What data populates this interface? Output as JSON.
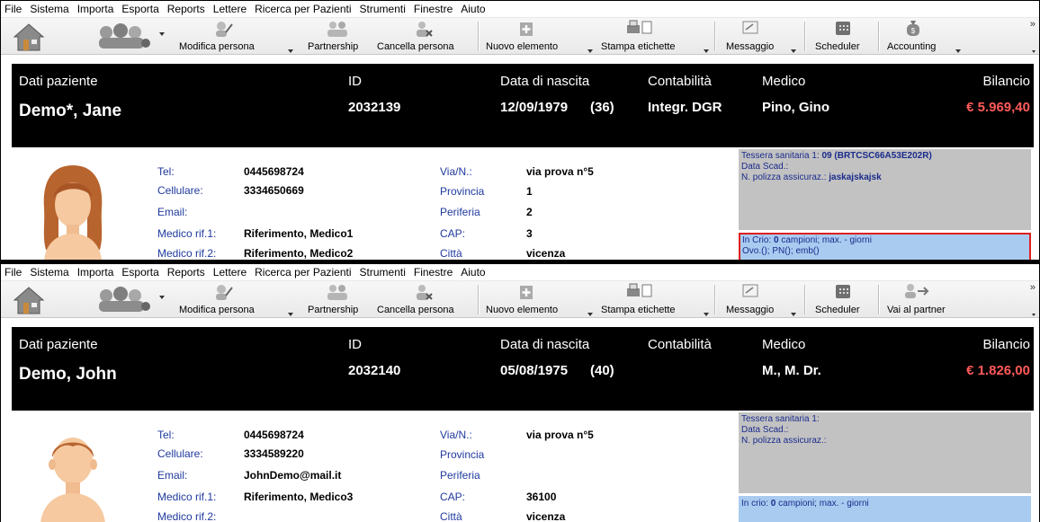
{
  "menu": [
    "File",
    "Sistema",
    "Importa",
    "Esporta",
    "Reports",
    "Lettere",
    "Ricerca per Pazienti",
    "Strumenti",
    "Finestre",
    "Aiuto"
  ],
  "toolbar": {
    "modifica": "Modifica persona",
    "partnership": "Partnership",
    "cancella": "Cancella persona",
    "nuovo": "Nuovo elemento",
    "stampa": "Stampa etichette",
    "messaggio": "Messaggio",
    "scheduler": "Scheduler",
    "accounting": "Accounting",
    "vai_partner": "Vai al partner",
    "more": "»"
  },
  "labels": {
    "dati_paziente": "Dati paziente",
    "id": "ID",
    "data_nascita": "Data di nascita",
    "contabilita": "Contabilità",
    "medico": "Medico",
    "bilancio": "Bilancio",
    "tel": "Tel:",
    "cellulare": "Cellulare:",
    "email": "Email:",
    "medico_rif1": "Medico rif.1:",
    "medico_rif2": "Medico rif.2:",
    "via": "Via/N.:",
    "provincia": "Provincia",
    "periferia": "Periferia",
    "cap": "CAP:",
    "citta": "Città",
    "data_scad": "Data Scad.:",
    "polizza": "N. polizza assicuraz.:"
  },
  "patients": [
    {
      "name": "Demo*, Jane",
      "id": "2032139",
      "birth": "12/09/1979",
      "age": "(36)",
      "contabilita": "Integr. DGR",
      "medico": "Pino, Gino",
      "bilancio": "€ 5.969,40",
      "tel": "0445698724",
      "cellulare": "3334650669",
      "email": "",
      "medico_rif1": "Riferimento, Medico1",
      "medico_rif2": "Riferimento, Medico2",
      "via": "via prova n°5",
      "provincia": "1",
      "periferia": "2",
      "cap": "3",
      "citta": "vicenza",
      "tessera_label": "Tessera sanitaria 1:",
      "tessera_value": "09  (BRTCSC66A53E202R)",
      "polizza_value": "jaskajskajsk",
      "crio_prefix": "In Crio:",
      "crio_count": "0",
      "crio_suffix": "campioni; max. - giorni",
      "crio_line2": "Ovo.(); PN(); emb()"
    },
    {
      "name": "Demo, John",
      "id": "2032140",
      "birth": "05/08/1975",
      "age": "(40)",
      "contabilita": "",
      "medico": "M., M. Dr.",
      "bilancio": "€ 1.826,00",
      "tel": "0445698724",
      "cellulare": "3334589220",
      "email": "JohnDemo@mail.it",
      "medico_rif1": "Riferimento, Medico3",
      "medico_rif2": "",
      "via": "via prova n°5",
      "provincia": "",
      "periferia": "",
      "cap": "36100",
      "citta": "vicenza",
      "tessera_label": "Tessera sanitaria 1:",
      "tessera_value": "",
      "polizza_value": "",
      "crio_prefix": "In crio:",
      "crio_count": "0",
      "crio_suffix": "campioni; max. - giorni",
      "crio_line2": ""
    }
  ],
  "colors": {
    "header_bg": "#000000",
    "balance_red": "#ff5a5a",
    "label_blue": "#1f3a9e",
    "crio_bg": "#a9cbf0",
    "tessera_bg": "#c2c2c2",
    "highlight_border": "#e02020"
  }
}
